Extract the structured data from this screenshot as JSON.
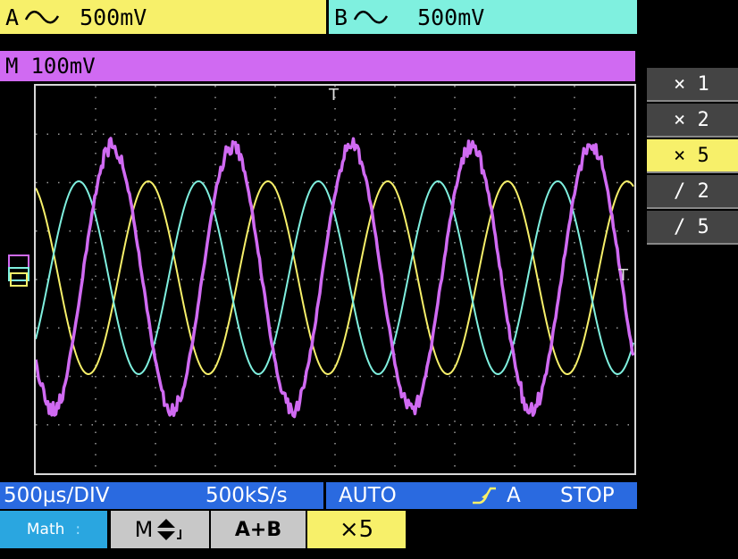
{
  "channel_a": {
    "name": "A",
    "coupling_icon": "ac-coupling-icon",
    "scale": "500mV",
    "color": "#f7f06a"
  },
  "channel_b": {
    "name": "B",
    "coupling_icon": "ac-coupling-icon",
    "scale": "500mV",
    "color": "#7ff0df"
  },
  "math": {
    "label": "M",
    "scale": "100mV",
    "color": "#d06af2"
  },
  "trigger_marker": "T",
  "zoom_menu": {
    "items": [
      "× 1",
      "× 2",
      "× 5",
      "/ 2",
      "/ 5"
    ],
    "selected_index": 2
  },
  "status": {
    "timebase": "500μs/DIV",
    "sample_rate": "500kS/s",
    "trigger_mode": "AUTO",
    "trigger_slope_icon": "rising-edge-icon",
    "trigger_source": "A",
    "run_state": "STOP",
    "color": "#2a6ae0"
  },
  "footer": {
    "math_label": "Math",
    "math_dot": ":",
    "move_label": "M",
    "move_icon": "up-down-arrows-icon",
    "sum_label": "A+B",
    "zoom_label": "×5"
  }
}
